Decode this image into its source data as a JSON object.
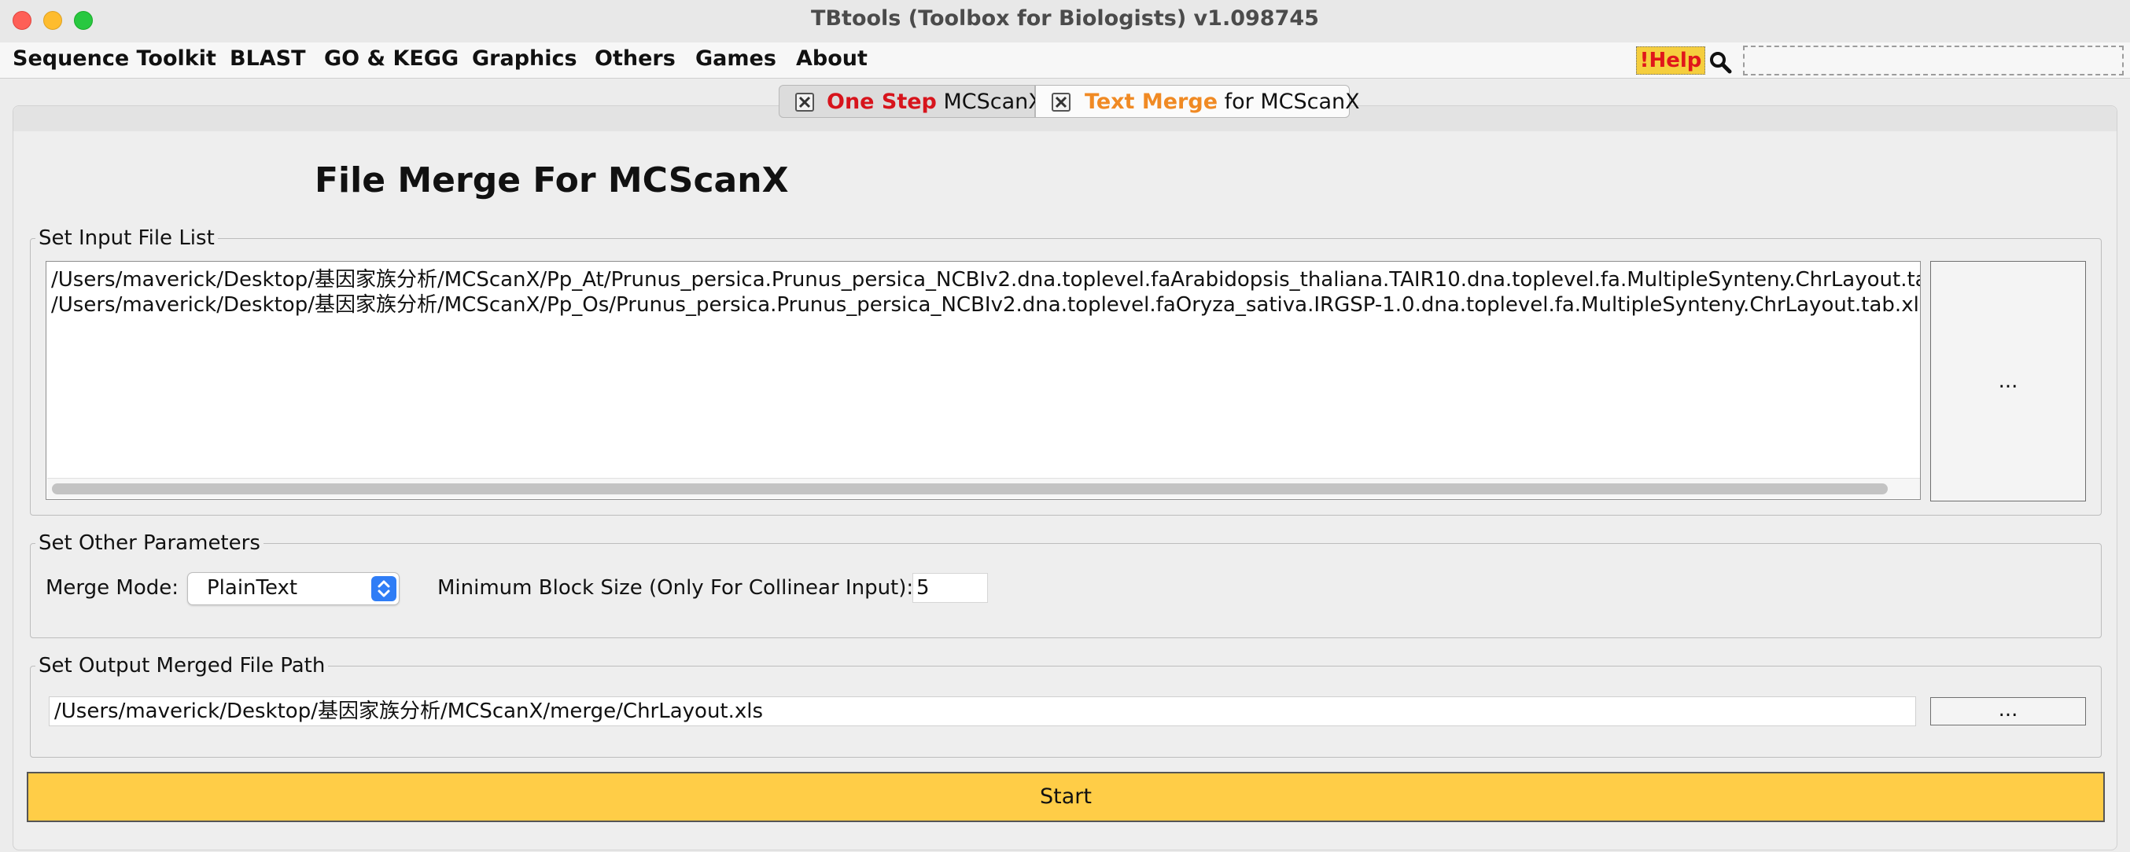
{
  "window": {
    "title": "TBtools (Toolbox for Biologists) v1.098745",
    "traffic_lights": {
      "close": "#fe5f57",
      "minimize": "#febc2e",
      "zoom": "#28c840"
    }
  },
  "menubar": {
    "items": [
      "Sequence Toolkit",
      "BLAST",
      "GO & KEGG",
      "Graphics",
      "Others",
      "Games",
      "About"
    ],
    "help_label": "!Help",
    "search_icon": "magnifier-icon"
  },
  "tabs": [
    {
      "accent": "One Step",
      "rest": "MCScanX",
      "accent_color": "#d7141c",
      "close_icon": "close-box-icon",
      "active": false
    },
    {
      "accent": "Text Merge",
      "rest": "for MCScanX",
      "accent_color": "#f08a24",
      "close_icon": "close-box-icon",
      "active": true
    }
  ],
  "main": {
    "title": "File Merge For MCScanX",
    "input_section": {
      "legend": "Set Input File List",
      "files": [
        "/Users/maverick/Desktop/基因家族分析/MCScanX/Pp_At/Prunus_persica.Prunus_persica_NCBIv2.dna.toplevel.faArabidopsis_thaliana.TAIR10.dna.toplevel.fa.MultipleSynteny.ChrLayout.tab.xls",
        "/Users/maverick/Desktop/基因家族分析/MCScanX/Pp_Os/Prunus_persica.Prunus_persica_NCBIv2.dna.toplevel.faOryza_sativa.IRGSP-1.0.dna.toplevel.fa.MultipleSynteny.ChrLayout.tab.xls"
      ],
      "browse_label": "..."
    },
    "params_section": {
      "legend": "Set Other Parameters",
      "merge_mode_label": "Merge Mode:",
      "merge_mode_value": "PlainText",
      "block_size_label": "Minimum Block Size (Only For Collinear Input):",
      "block_size_value": "5"
    },
    "output_section": {
      "legend": "Set Output Merged File Path",
      "path": "/Users/maverick/Desktop/基因家族分析/MCScanX/merge/ChrLayout.xls",
      "browse_label": "..."
    },
    "start_label": "Start",
    "accent_color": "#ffcd47"
  }
}
